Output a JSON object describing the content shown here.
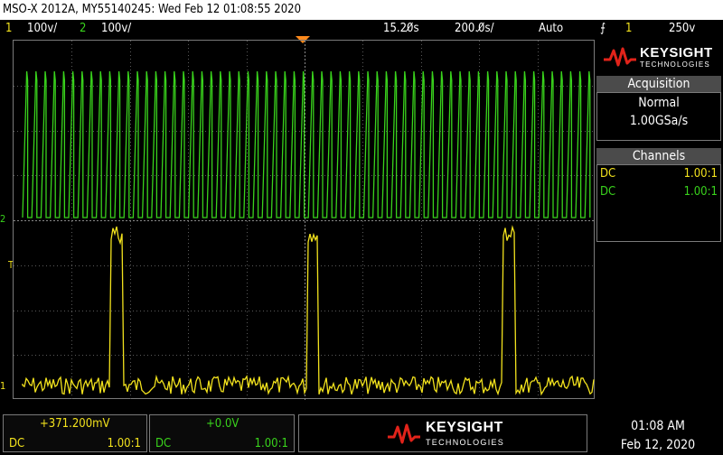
{
  "title_bar": "MSO-X 2012A, MY55140245: Wed Feb 12 01:08:55 2020",
  "status": {
    "ch1_num": "1",
    "ch1_scale": "100ᴠ/",
    "ch2_num": "2",
    "ch2_scale": "100ᴠ/",
    "delay": "15.20̸s",
    "timebase": "200.0̸s/",
    "trigger_mode": "Auto",
    "trigger_source": "1",
    "trigger_level": "250ᴠ"
  },
  "brand": {
    "name": "KEYSIGHT",
    "sub": "TECHNOLOGIES"
  },
  "acquisition": {
    "header": "Acquisition",
    "mode": "Normal",
    "rate": "1.00GSa/s"
  },
  "channels": {
    "header": "Channels",
    "rows": [
      {
        "coupling": "DC",
        "ratio": "1.00:1",
        "color": "#f2e21d"
      },
      {
        "coupling": "DC",
        "ratio": "1.00:1",
        "color": "#39d21c"
      }
    ]
  },
  "bottom": {
    "ch1": {
      "offset": "+371.200mV",
      "coupling": "DC",
      "ratio": "1.00:1"
    },
    "ch2": {
      "offset": "+0.0V",
      "coupling": "DC",
      "ratio": "1.00:1"
    },
    "time": "01:08 AM",
    "date": "Feb 12, 2020"
  },
  "markers": {
    "ch2_ground": "2",
    "trigger": "T",
    "ch1_ground": "1"
  },
  "colors": {
    "ch1": "#f2e21d",
    "ch2": "#39d21c",
    "trigger_marker": "#ff8a1c",
    "grid": "#5a5a5a"
  }
}
